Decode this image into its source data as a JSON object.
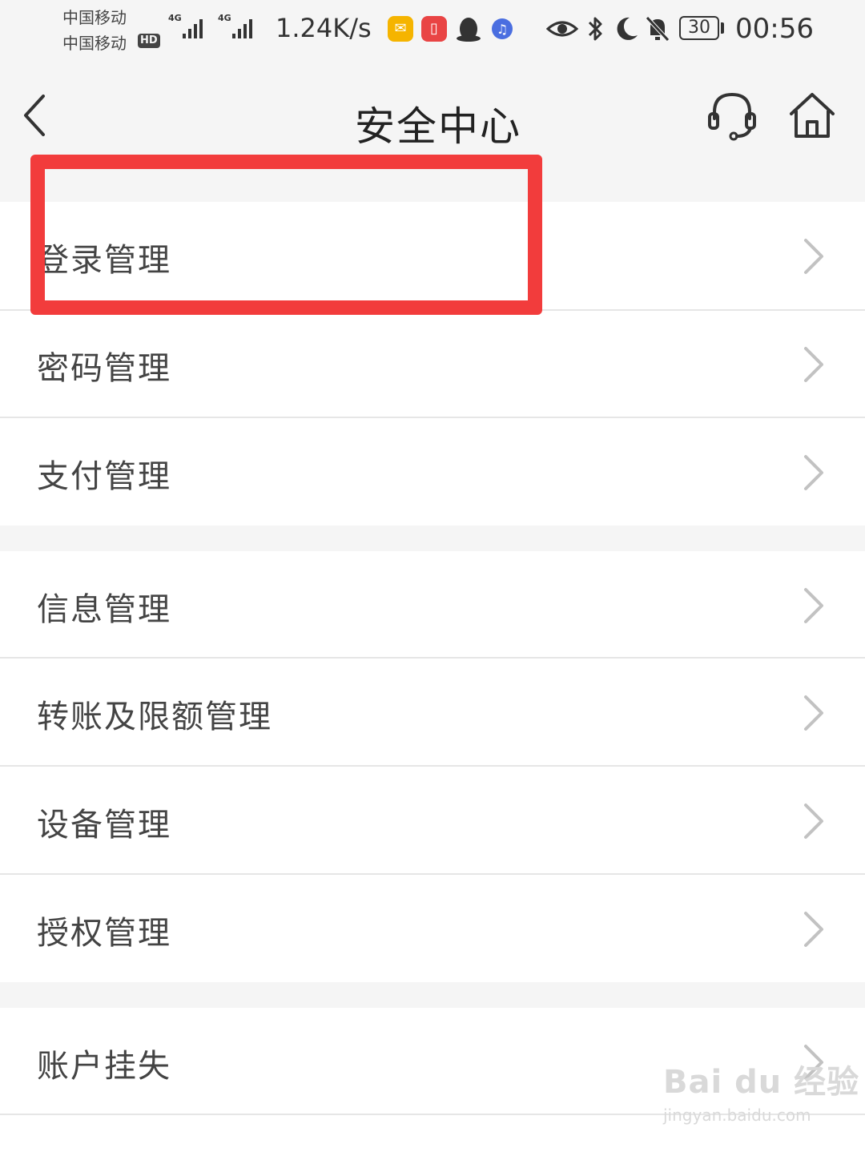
{
  "status_bar": {
    "carrier_1": "中国移动",
    "carrier_2": "中国移动",
    "hd_badge": "HD",
    "signal_1_type": "4G",
    "signal_2_type": "4G",
    "net_speed": "1.24K/s",
    "battery_level": "30",
    "time": "00:56",
    "icons": [
      "mail-app-icon",
      "book-app-icon",
      "qq-icon",
      "music-app-icon",
      "eye-icon",
      "bluetooth-icon",
      "moon-icon",
      "mute-bell-icon"
    ]
  },
  "nav": {
    "title": "安全中心",
    "back_icon": "chevron-left-icon",
    "service_icon": "headset-icon",
    "home_icon": "home-icon"
  },
  "groups": [
    {
      "items": [
        {
          "label": "登录管理"
        },
        {
          "label": "密码管理"
        },
        {
          "label": "支付管理"
        }
      ]
    },
    {
      "items": [
        {
          "label": "信息管理"
        },
        {
          "label": "转账及限额管理"
        },
        {
          "label": "设备管理"
        },
        {
          "label": "授权管理"
        }
      ]
    },
    {
      "items": [
        {
          "label": "账户挂失"
        }
      ]
    }
  ],
  "colors": {
    "highlight": "#f23c3c",
    "background": "#f5f5f5",
    "text": "#444444"
  },
  "watermark": {
    "main": "Bai du 经验",
    "sub": "jingyan.baidu.com"
  }
}
